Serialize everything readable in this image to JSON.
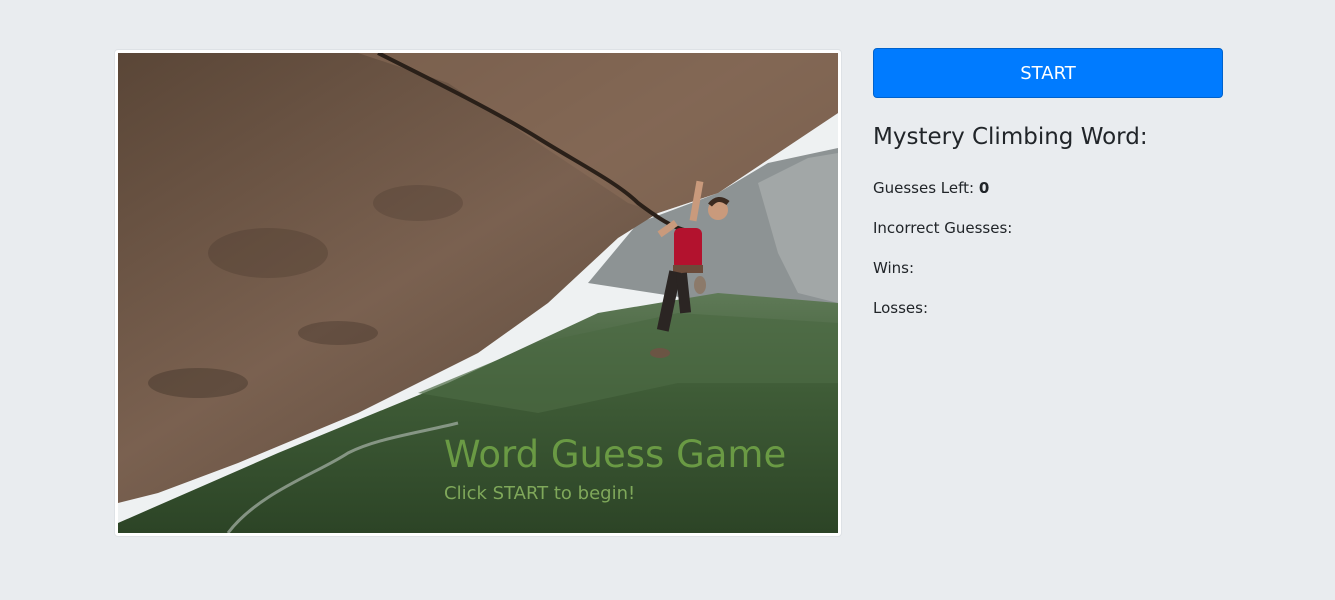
{
  "game": {
    "title": "Word Guess Game",
    "subtitle": "Click START to begin!"
  },
  "controls": {
    "start_label": "START",
    "accent_color": "#007bff"
  },
  "board": {
    "heading": "Mystery Climbing Word:",
    "guesses_left_label": "Guesses Left: ",
    "guesses_left_value": "0",
    "incorrect_label": "Incorrect Guesses:",
    "incorrect_value": "",
    "wins_label": "Wins:",
    "wins_value": "",
    "losses_label": "Losses:",
    "losses_value": ""
  },
  "image": {
    "subject": "climber on rock overhang above forested valley"
  }
}
